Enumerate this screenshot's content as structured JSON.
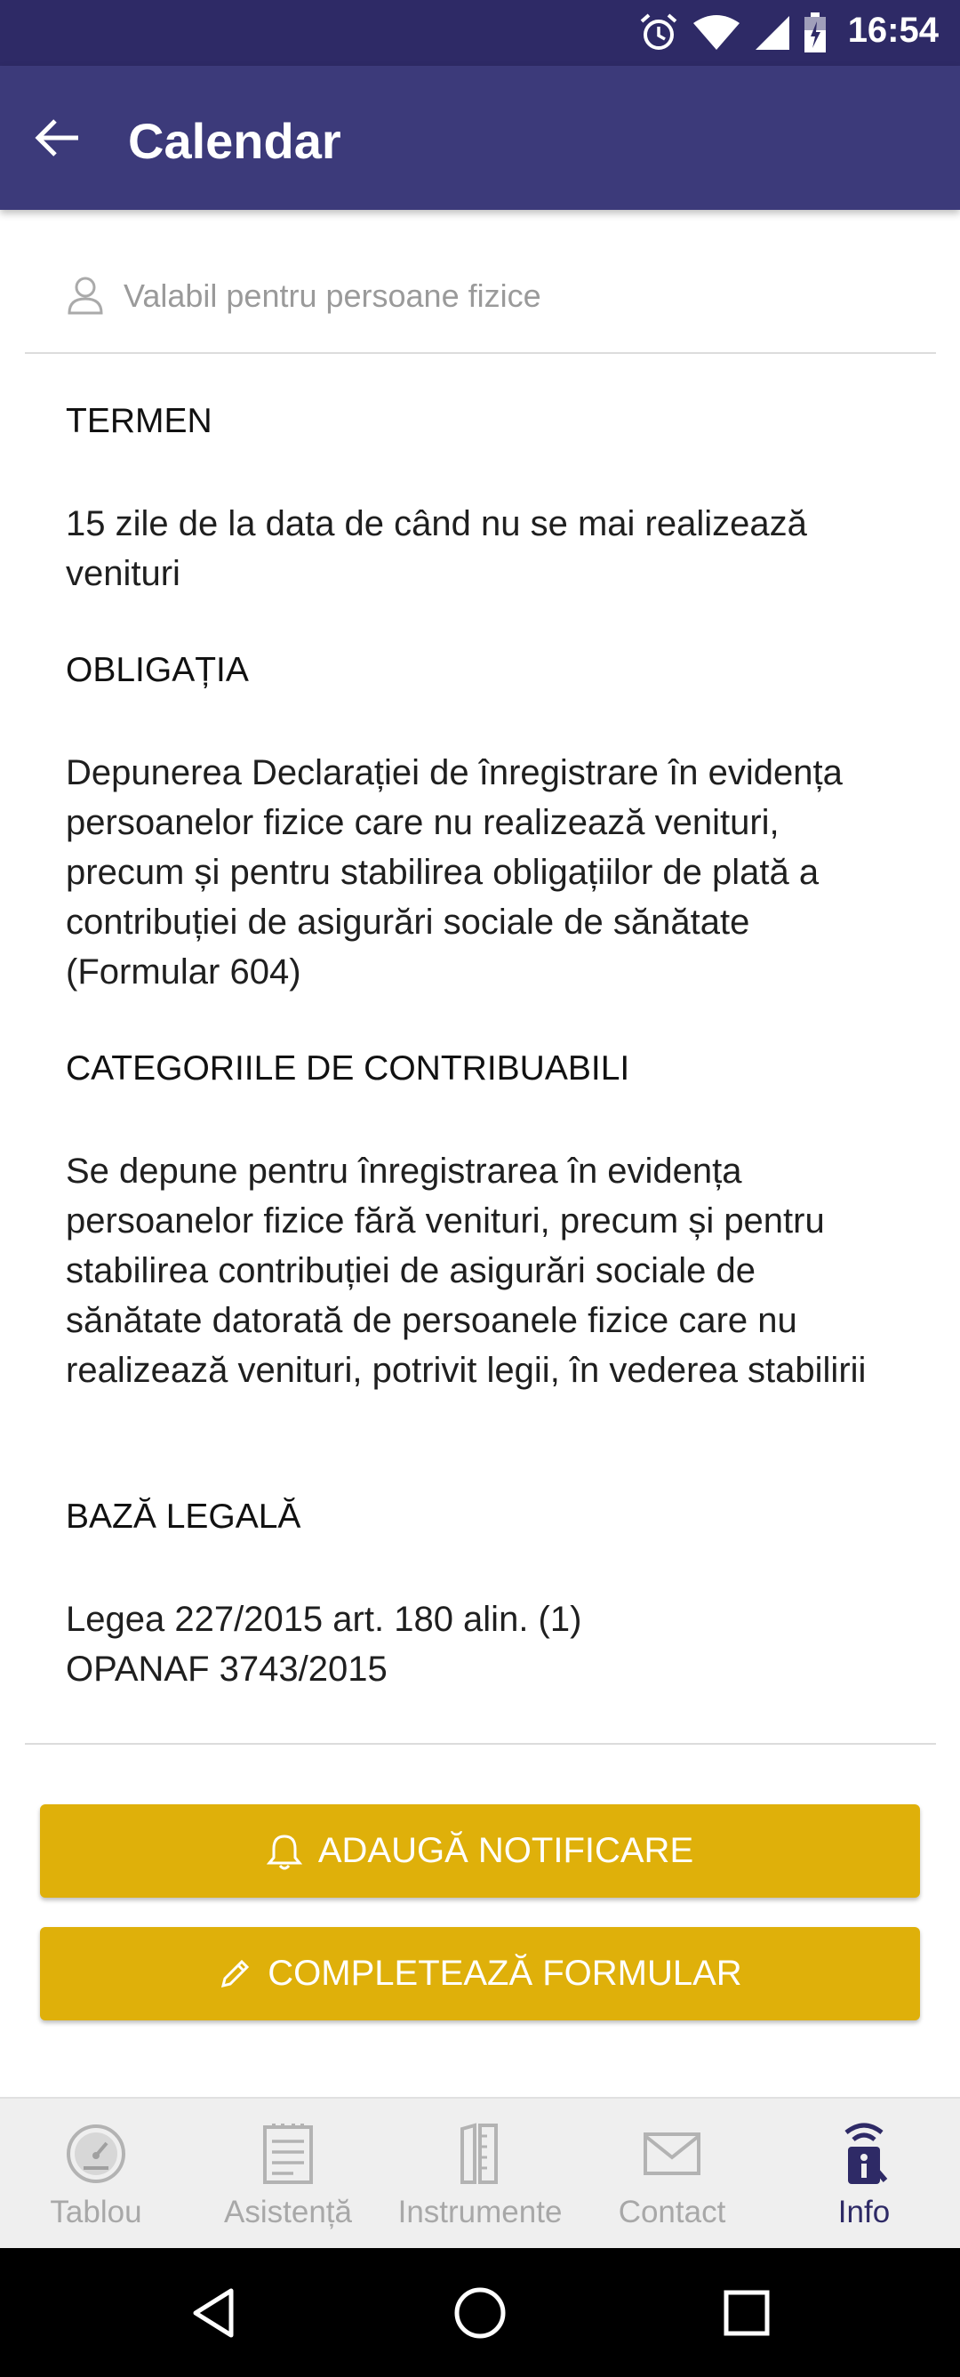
{
  "status_bar": {
    "time": "16:54",
    "icons": [
      "alarm-icon",
      "wifi-icon",
      "signal-icon",
      "battery-icon"
    ]
  },
  "app_bar": {
    "title": "Calendar"
  },
  "subtitle": "Valabil pentru persoane fizice",
  "sections": [
    {
      "heading": "TERMEN",
      "text": "15 zile de la data de când nu se mai realizează venituri"
    },
    {
      "heading": "OBLIGAȚIA",
      "text": "Depunerea Declarației de înregistrare în evidența persoanelor fizice care nu realizează venituri, precum și pentru stabilirea obligațiilor de plată a contribuției de asigurări sociale de sănătate (Formular 604)"
    },
    {
      "heading": "CATEGORIILE DE CONTRIBUABILI",
      "text": "Se depune pentru înregistrarea în evidența persoanelor fizice fără venituri, precum și pentru stabilirea contribuției de asigurări sociale de sănătate datorată de persoanele fizice care nu realizează venituri, potrivit legii, în vederea stabilirii"
    },
    {
      "heading": "BAZĂ LEGALĂ",
      "lines": [
        "Legea 227/2015 art. 180 alin. (1)",
        "OPANAF 3743/2015"
      ]
    }
  ],
  "buttons": {
    "add_notification": "ADAUGĂ NOTIFICARE",
    "fill_form": "COMPLETEAZĂ FORMULAR"
  },
  "bottom_nav": [
    {
      "label": "Tablou",
      "icon": "dashboard-icon",
      "active": false
    },
    {
      "label": "Asistență",
      "icon": "clipboard-icon",
      "active": false
    },
    {
      "label": "Instrumente",
      "icon": "tools-icon",
      "active": false
    },
    {
      "label": "Contact",
      "icon": "mail-icon",
      "active": false
    },
    {
      "label": "Info",
      "icon": "info-icon",
      "active": true
    }
  ],
  "colors": {
    "status_bar": "#2e2a66",
    "app_bar": "#3c3a7a",
    "button": "#dfb00a",
    "nav_active": "#2e2a66",
    "nav_inactive": "#a8a8a8"
  }
}
